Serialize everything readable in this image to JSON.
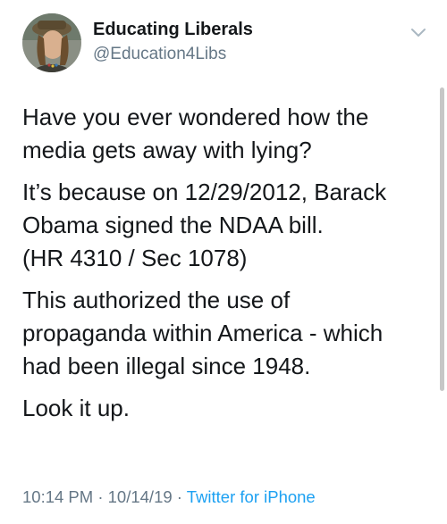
{
  "user": {
    "display_name": "Educating Liberals",
    "handle": "@Education4Libs"
  },
  "tweet": {
    "paragraphs": [
      "Have you ever wondered how the\nmedia gets away with lying?",
      "It’s because on 12/29/2012, Barack\nObama signed the NDAA bill.\n(HR 4310 / Sec 1078)",
      "This authorized the use of\npropaganda within America - which\nhad been illegal since 1948.",
      "Look it up."
    ],
    "time": "10:14 PM",
    "separator1": " · ",
    "date": "10/14/19",
    "separator2": " · ",
    "source": "Twitter for iPhone"
  },
  "icons": {
    "menu": "chevron-down-icon",
    "avatar": "avatar"
  },
  "colors": {
    "text": "#14171a",
    "secondary": "#657786",
    "link": "#1da1f2"
  }
}
